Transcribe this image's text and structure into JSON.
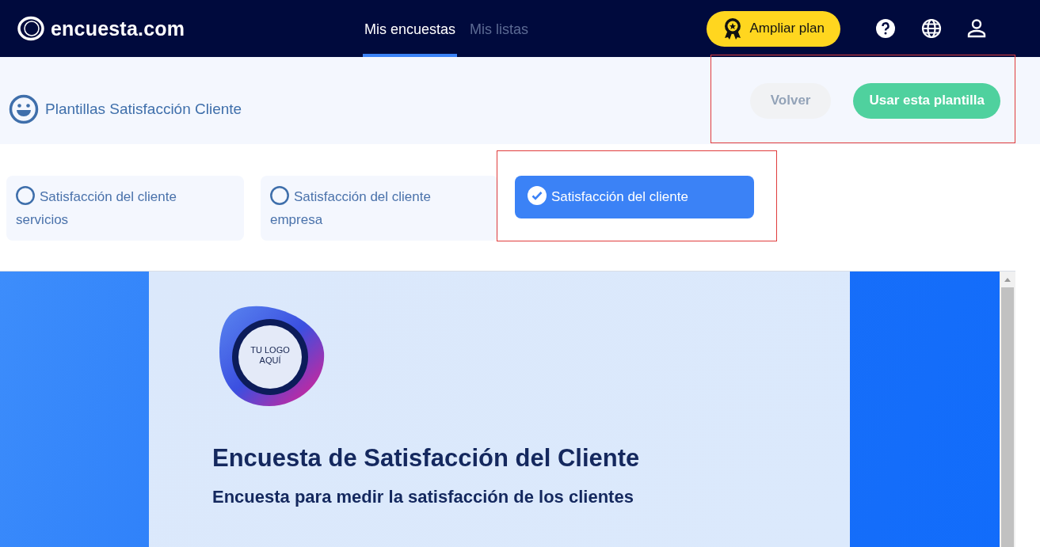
{
  "brand": "encuesta.com",
  "nav_tabs": [
    {
      "label": "Mis encuestas",
      "selected": true
    },
    {
      "label": "Mis listas",
      "selected": false
    }
  ],
  "upgrade_button": "Ampliar plan",
  "page_title": "Plantillas Satisfacción Cliente",
  "buttons": [
    {
      "label": "Volver",
      "kind": "secondary"
    },
    {
      "label": "Usar esta plantilla",
      "kind": "primary"
    }
  ],
  "templates": [
    {
      "label": "Satisfacción del cliente servicios",
      "selected": false
    },
    {
      "label": "Satisfacción del cliente empresa",
      "selected": false
    },
    {
      "label": "Satisfacción del cliente",
      "selected": true
    }
  ],
  "preview": {
    "logo_lines": [
      "TU LOGO",
      "AQUÍ"
    ],
    "title": "Encuesta de Satisfacción del Cliente",
    "subtitle": "Encuesta para medir la satisfacción de los clientes"
  }
}
